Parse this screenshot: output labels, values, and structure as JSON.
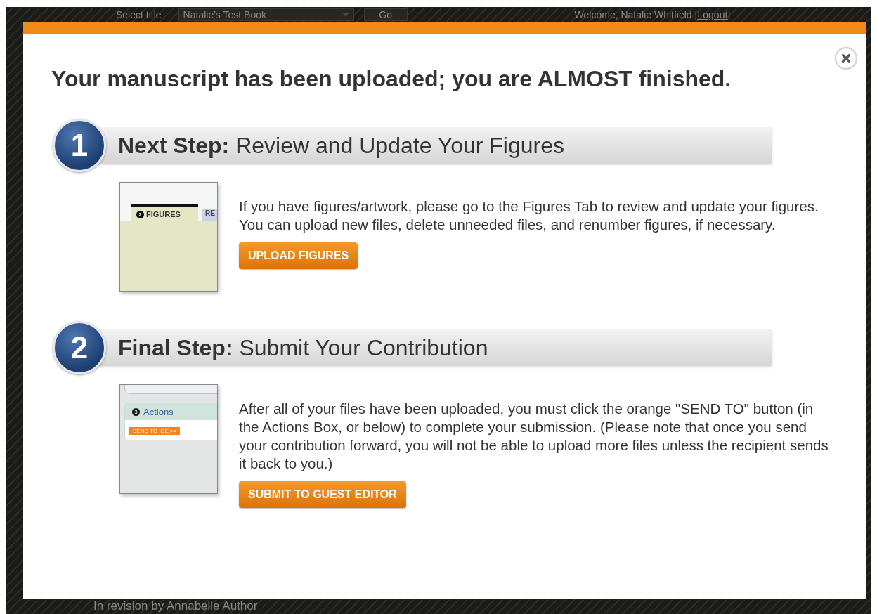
{
  "background_page": {
    "top_bar": {
      "select_label": "Select title",
      "title_select": "Natalie's Test Book",
      "go_button": "Go",
      "welcome": "Welcome, Natalie Whitfield",
      "logout_link": "[Logout]"
    },
    "footer_text": "In revision by Annabelle Author"
  },
  "dialog": {
    "heading": "Your manuscript has been uploaded; you are ALMOST finished.",
    "steps": [
      {
        "number": "1",
        "title": "**Next Step:** Review and Update Your Figures",
        "kind": "figures",
        "thumbnail": {
          "tab_number": "2",
          "tab_label": "FIGURES",
          "next_tab_label": "RE"
        },
        "description": "If you have figures/artwork, please go to the Figures Tab to review and update your figures. You can upload new files, delete unneeded files, and renumber figures, if necessary.",
        "button": "UPLOAD FIGURES"
      },
      {
        "number": "2",
        "title": "**Final Step:** Submit Your Contribution",
        "kind": "actions",
        "thumbnail": {
          "box_number": "3",
          "box_title": "Actions",
          "send_button": "SEND TO  DE >>"
        },
        "description": "After all of your files have been uploaded, you must click the orange \"SEND TO\" button (in the Actions Box, or below) to complete your submission. (Please note that once you send your contribution forward, you will not be able to upload more files unless the recipient sends it back to you.)",
        "button": "SUBMIT TO GUEST EDITOR"
      }
    ]
  }
}
